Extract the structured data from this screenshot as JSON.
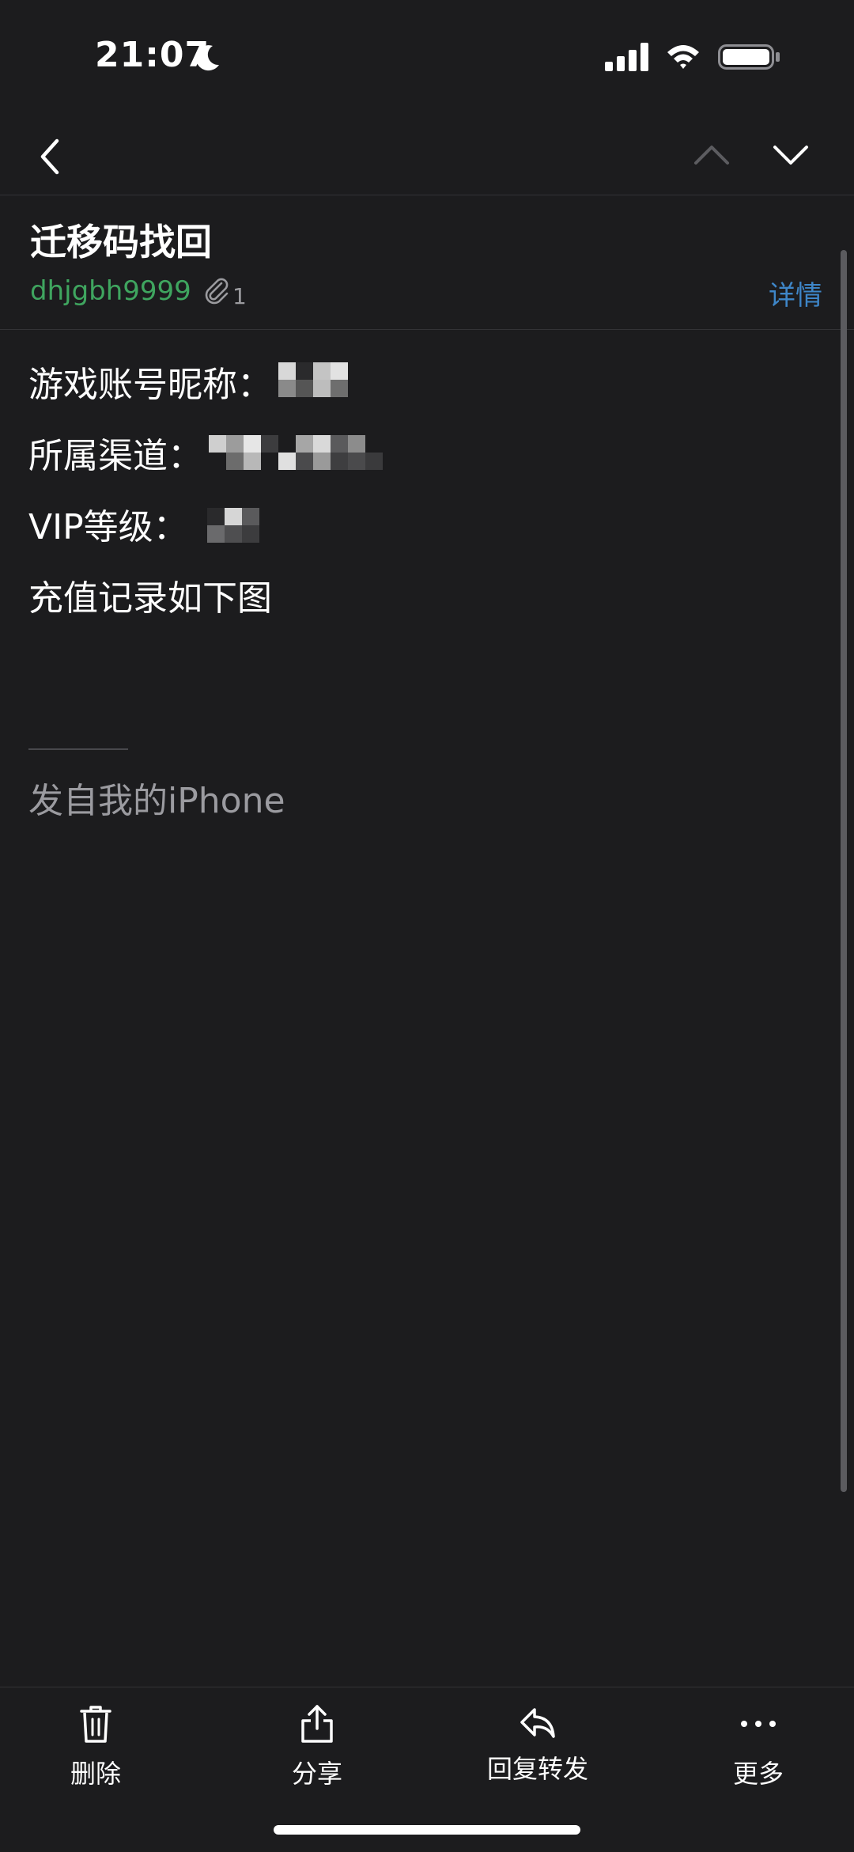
{
  "status_bar": {
    "time": "21:07",
    "icons": [
      "moon-icon",
      "signal-icon",
      "wifi-icon",
      "battery-icon"
    ]
  },
  "nav": {
    "icons": [
      "back-icon",
      "chevron-up-icon",
      "chevron-down-icon"
    ]
  },
  "mail": {
    "subject": "迁移码找回",
    "sender": "dhjgbh9999",
    "attachment_count": "1",
    "detail_label": "详情"
  },
  "body": {
    "lines": [
      "游戏账号昵称：",
      "所属渠道：",
      "VIP等级：",
      "充值记录如下图"
    ],
    "signature": "发自我的iPhone"
  },
  "toolbar": {
    "delete_label": "删除",
    "share_label": "分享",
    "reply_forward_label": "回复转发",
    "more_label": "更多"
  },
  "colors": {
    "background": "#1c1c1e",
    "sender": "#3fa55f",
    "link": "#3e86c8",
    "secondary_text": "#9b9ba0"
  }
}
